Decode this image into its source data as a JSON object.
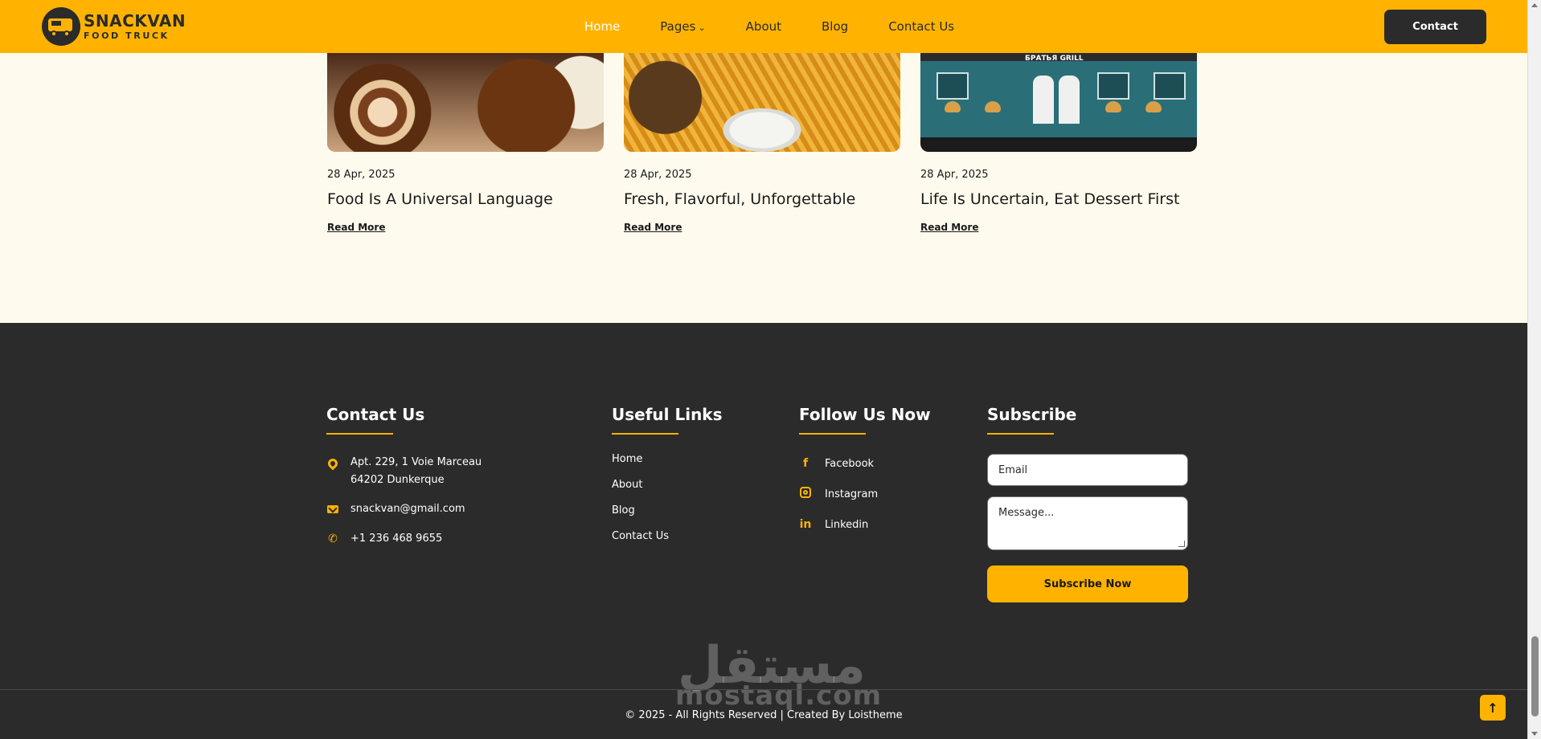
{
  "header": {
    "brand_name": "SNACKVAN",
    "brand_sub": "FOOD TRUCK",
    "nav": [
      {
        "label": "Home"
      },
      {
        "label": "Pages"
      },
      {
        "label": "About"
      },
      {
        "label": "Blog"
      },
      {
        "label": "Contact Us"
      }
    ],
    "contact_button": "Contact"
  },
  "blog": {
    "cards": [
      {
        "date": "28 Apr, 2025",
        "title": "Food Is A Universal Language",
        "read_more": "Read More"
      },
      {
        "date": "28 Apr, 2025",
        "title": "Fresh, Flavorful, Unforgettable",
        "read_more": "Read More"
      },
      {
        "date": "28 Apr, 2025",
        "title": "Life Is Uncertain, Eat Dessert First",
        "read_more": "Read More"
      }
    ],
    "truck_sign": "БРАТЬЯ GRILL"
  },
  "footer": {
    "contact": {
      "heading": "Contact Us",
      "address_line1": "Apt. 229, 1 Voie Marceau",
      "address_line2": "64202 Dunkerque",
      "email": "snackvan@gmail.com",
      "phone": "+1 236 468 9655"
    },
    "links": {
      "heading": "Useful Links",
      "items": [
        "Home",
        "About",
        "Blog",
        "Contact Us"
      ]
    },
    "follow": {
      "heading": "Follow Us Now",
      "items": [
        {
          "label": "Facebook",
          "icon": "facebook-icon"
        },
        {
          "label": "Instagram",
          "icon": "instagram-icon"
        },
        {
          "label": "Linkedin",
          "icon": "linkedin-icon"
        }
      ]
    },
    "subscribe": {
      "heading": "Subscribe",
      "email_placeholder": "Email",
      "message_placeholder": "Message...",
      "button": "Subscribe Now"
    },
    "copyright": "© 2025 - All Rights Reserved | Created By Loistheme",
    "watermark_arabic": "مستقل",
    "watermark_latin": "mostaql.com"
  },
  "colors": {
    "accent": "#ffb300",
    "dark": "#2b2b2b",
    "cream": "#fffaee"
  }
}
